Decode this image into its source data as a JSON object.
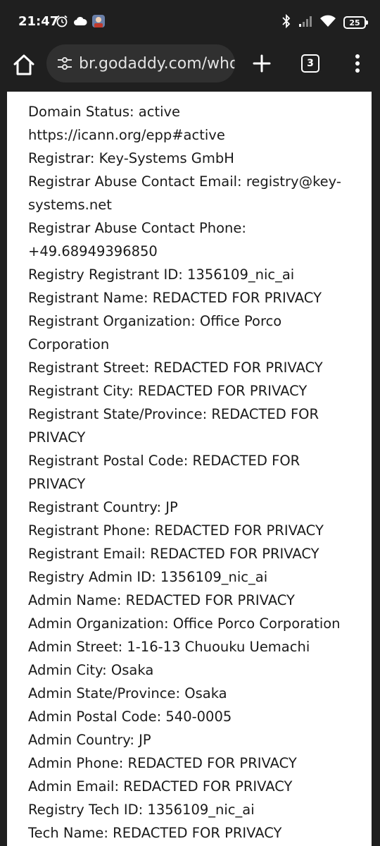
{
  "status_bar": {
    "time": "21:47",
    "left_icons": [
      "alarm-icon",
      "cloud-icon",
      "app-avatar-icon"
    ],
    "right_icons": [
      "bluetooth-icon",
      "cellular-signal-icon",
      "wifi-icon"
    ],
    "battery_level": "25"
  },
  "browser": {
    "url": "br.godaddy.com/whois",
    "tab_count": "3"
  },
  "whois_lines": [
    "Domain Status: active",
    "https://icann.org/epp#active",
    "Registrar: Key-Systems GmbH",
    "Registrar Abuse Contact Email: registry@key-",
    "systems.net",
    "Registrar Abuse Contact Phone:",
    "+49.68949396850",
    "Registry Registrant ID: 1356109_nic_ai",
    "Registrant Name: REDACTED FOR PRIVACY",
    "Registrant Organization: Office Porco",
    "Corporation",
    "Registrant Street: REDACTED FOR PRIVACY",
    "Registrant City: REDACTED FOR PRIVACY",
    "Registrant State/Province: REDACTED FOR",
    "PRIVACY",
    "Registrant Postal Code: REDACTED FOR",
    "PRIVACY",
    "Registrant Country: JP",
    "Registrant Phone: REDACTED FOR PRIVACY",
    "Registrant Email: REDACTED FOR PRIVACY",
    "Registry Admin ID: 1356109_nic_ai",
    "Admin Name: REDACTED FOR PRIVACY",
    "Admin Organization: Office Porco Corporation",
    "Admin Street: 1-16-13 Chuouku Uemachi",
    "Admin City: Osaka",
    "Admin State/Province: Osaka",
    "Admin Postal Code: 540-0005",
    "Admin Country: JP",
    "Admin Phone: REDACTED FOR PRIVACY",
    "Admin Email: REDACTED FOR PRIVACY",
    "Registry Tech ID: 1356109_nic_ai",
    "Tech Name: REDACTED FOR PRIVACY"
  ]
}
